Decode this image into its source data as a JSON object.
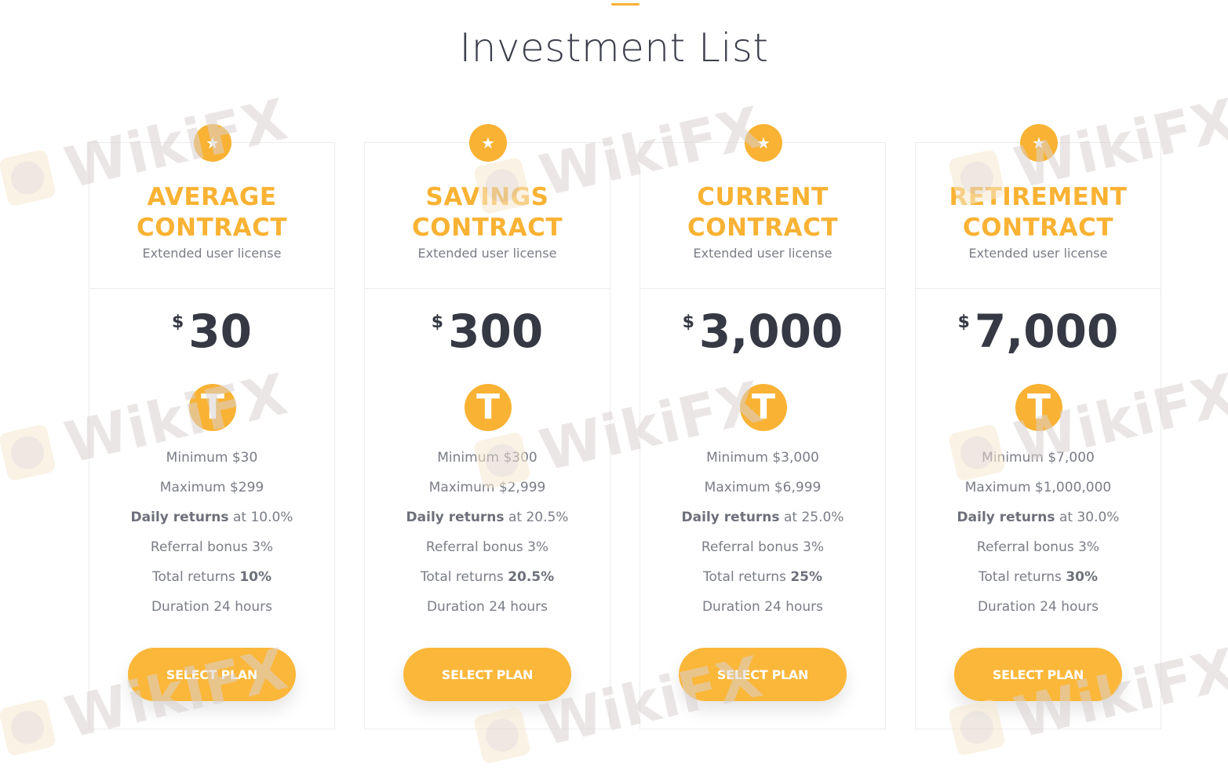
{
  "page": {
    "title": "Investment List"
  },
  "plans": [
    {
      "name_line1": "AVERAGE",
      "name_line2": "CONTRACT",
      "subtitle": "Extended user license",
      "currency": "$",
      "amount": "30",
      "coin_glyph": "T",
      "minimum": "Minimum $30",
      "maximum": "Maximum $299",
      "daily_label": "Daily returns",
      "daily_rest": "at 10.0%",
      "referral": "Referral bonus 3%",
      "total_label": "Total returns",
      "total_value": "10%",
      "duration": "Duration 24 hours",
      "button": "SELECT PLAN"
    },
    {
      "name_line1": "SAVINGS",
      "name_line2": "CONTRACT",
      "subtitle": "Extended user license",
      "currency": "$",
      "amount": "300",
      "coin_glyph": "T",
      "minimum": "Minimum $300",
      "maximum": "Maximum $2,999",
      "daily_label": "Daily returns",
      "daily_rest": "at 20.5%",
      "referral": "Referral bonus 3%",
      "total_label": "Total returns",
      "total_value": "20.5%",
      "duration": "Duration 24 hours",
      "button": "SELECT PLAN"
    },
    {
      "name_line1": "CURRENT",
      "name_line2": "CONTRACT",
      "subtitle": "Extended user license",
      "currency": "$",
      "amount": "3,000",
      "coin_glyph": "T",
      "minimum": "Minimum $3,000",
      "maximum": "Maximum $6,999",
      "daily_label": "Daily returns",
      "daily_rest": "at 25.0%",
      "referral": "Referral bonus 3%",
      "total_label": "Total returns",
      "total_value": "25%",
      "duration": "Duration 24 hours",
      "button": "SELECT PLAN"
    },
    {
      "name_line1": "RETIREMENT",
      "name_line2": "CONTRACT",
      "subtitle": "Extended user license",
      "currency": "$",
      "amount": "7,000",
      "coin_glyph": "T",
      "minimum": "Minimum $7,000",
      "maximum": "Maximum $1,000,000",
      "daily_label": "Daily returns",
      "daily_rest": "at 30.0%",
      "referral": "Referral bonus 3%",
      "total_label": "Total returns",
      "total_value": "30%",
      "duration": "Duration 24 hours",
      "button": "SELECT PLAN"
    }
  ],
  "icons": {
    "badge": "star-icon",
    "coin": "tether-coin-icon"
  },
  "colors": {
    "accent": "#f9b233",
    "button": "#fbb73a",
    "text_dark": "#363944",
    "text_muted": "#7a7d86"
  },
  "watermark": {
    "text": "WikiFX"
  }
}
